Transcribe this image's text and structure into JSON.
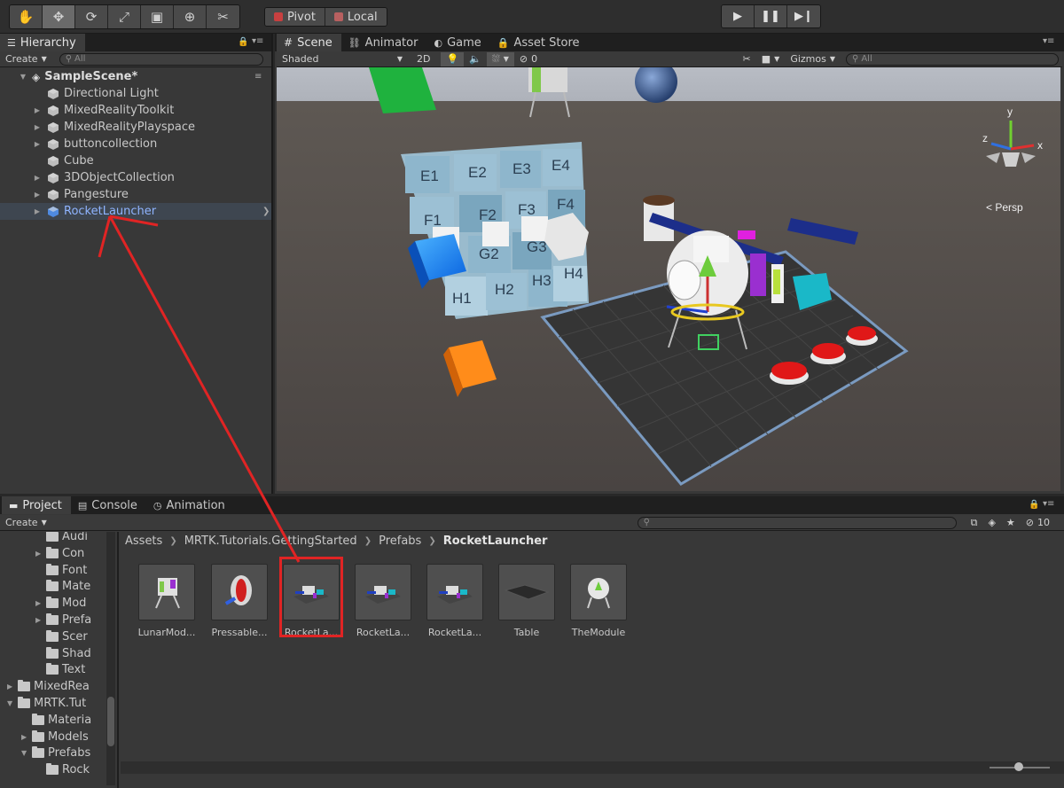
{
  "toolbar": {
    "tools": [
      "hand-icon",
      "move-icon",
      "rotate-icon",
      "scale-icon",
      "rect-icon",
      "transform-icon",
      "custom-tool-icon"
    ],
    "pivot_label": "Pivot",
    "local_label": "Local"
  },
  "hierarchy": {
    "tab_label": "Hierarchy",
    "create_label": "Create",
    "search_placeholder": "All",
    "scene_name": "SampleScene*",
    "items": [
      {
        "label": "Directional Light",
        "has_children": false
      },
      {
        "label": "MixedRealityToolkit",
        "has_children": true
      },
      {
        "label": "MixedRealityPlayspace",
        "has_children": true
      },
      {
        "label": "buttoncollection",
        "has_children": true
      },
      {
        "label": "Cube",
        "has_children": false
      },
      {
        "label": "3DObjectCollection",
        "has_children": true
      },
      {
        "label": "Pangesture",
        "has_children": true
      },
      {
        "label": "RocketLauncher",
        "has_children": true
      }
    ]
  },
  "scene": {
    "tabs": [
      "Scene",
      "Animator",
      "Game",
      "Asset Store"
    ],
    "shading": "Shaded",
    "mode_2d": "2D",
    "hidden_count": "0",
    "gizmos_label": "Gizmos",
    "search_placeholder": "All",
    "persp_label": "Persp",
    "axis_y": "y",
    "axis_x": "x",
    "axis_z": "z",
    "grid_labels": [
      "E1",
      "E2",
      "E3",
      "E4",
      "F1",
      "F2",
      "F3",
      "F4",
      "G2",
      "G3",
      "H1",
      "H2",
      "H3",
      "H4"
    ]
  },
  "project": {
    "tabs": [
      "Project",
      "Console",
      "Animation"
    ],
    "create_label": "Create",
    "count_label": "10",
    "tree": [
      {
        "label": "Audi",
        "indent": 3,
        "arrow": false
      },
      {
        "label": "Con",
        "indent": 3,
        "arrow": true
      },
      {
        "label": "Font",
        "indent": 3,
        "arrow": false
      },
      {
        "label": "Mate",
        "indent": 3,
        "arrow": false
      },
      {
        "label": "Mod",
        "indent": 3,
        "arrow": true
      },
      {
        "label": "Prefa",
        "indent": 3,
        "arrow": true
      },
      {
        "label": "Scer",
        "indent": 3,
        "arrow": false
      },
      {
        "label": "Shad",
        "indent": 3,
        "arrow": false
      },
      {
        "label": "Text",
        "indent": 3,
        "arrow": false
      },
      {
        "label": "MixedRea",
        "indent": 1,
        "arrow": true
      },
      {
        "label": "MRTK.Tut",
        "indent": 1,
        "arrow": "open"
      },
      {
        "label": "Materia",
        "indent": 2,
        "arrow": false
      },
      {
        "label": "Models",
        "indent": 2,
        "arrow": true
      },
      {
        "label": "Prefabs",
        "indent": 2,
        "arrow": "open"
      },
      {
        "label": "Rock",
        "indent": 3,
        "arrow": false
      }
    ],
    "breadcrumb": [
      "Assets",
      "MRTK.Tutorials.GettingStarted",
      "Prefabs",
      "RocketLauncher"
    ],
    "assets": [
      "LunarMod...",
      "Pressable...",
      "RocketLa...",
      "RocketLa...",
      "RocketLa...",
      "Table",
      "TheModule"
    ]
  },
  "colors": {
    "highlight_red": "#e02424",
    "selected_text": "#8fb4ff"
  }
}
